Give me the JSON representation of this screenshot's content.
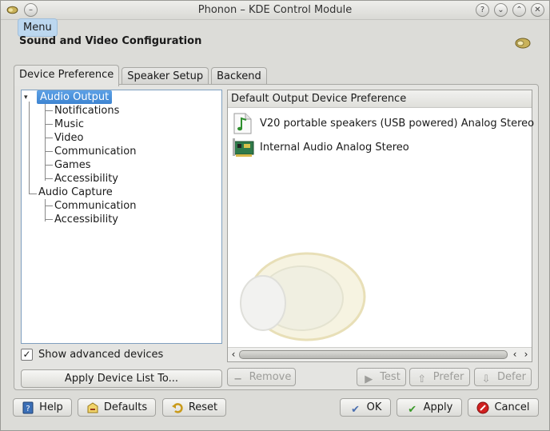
{
  "window": {
    "title": "Phonon – KDE Control Module"
  },
  "menu": {
    "label": "Menu"
  },
  "page": {
    "title": "Sound and Video Configuration"
  },
  "tabs": [
    {
      "label": "Device Preference",
      "active": true
    },
    {
      "label": "Speaker Setup",
      "active": false
    },
    {
      "label": "Backend",
      "active": false
    }
  ],
  "tree": {
    "categories": [
      {
        "label": "Audio Output",
        "selected": true,
        "children": [
          "Notifications",
          "Music",
          "Video",
          "Communication",
          "Games",
          "Accessibility"
        ]
      },
      {
        "label": "Audio Capture",
        "selected": false,
        "children": [
          "Communication",
          "Accessibility"
        ]
      }
    ]
  },
  "show_advanced": {
    "label": "Show advanced devices",
    "checked": true
  },
  "apply_list_button": {
    "label": "Apply Device List To..."
  },
  "device_list": {
    "header": "Default Output Device Preference",
    "devices": [
      {
        "label": "V20 portable speakers (USB powered) Analog Stereo",
        "icon": "music-note-icon"
      },
      {
        "label": "Internal Audio Analog Stereo",
        "icon": "sound-card-icon"
      }
    ]
  },
  "device_buttons": {
    "remove": "Remove",
    "test": "Test",
    "prefer": "Prefer",
    "defer": "Defer"
  },
  "footer": {
    "help": "Help",
    "defaults": "Defaults",
    "reset": "Reset",
    "ok": "OK",
    "apply": "Apply",
    "cancel": "Cancel"
  },
  "colors": {
    "selection": "#4a90d9",
    "cancel_icon": "#d02020",
    "apply_icon": "#3a9a2a",
    "ok_icon": "#4a6fb0"
  }
}
